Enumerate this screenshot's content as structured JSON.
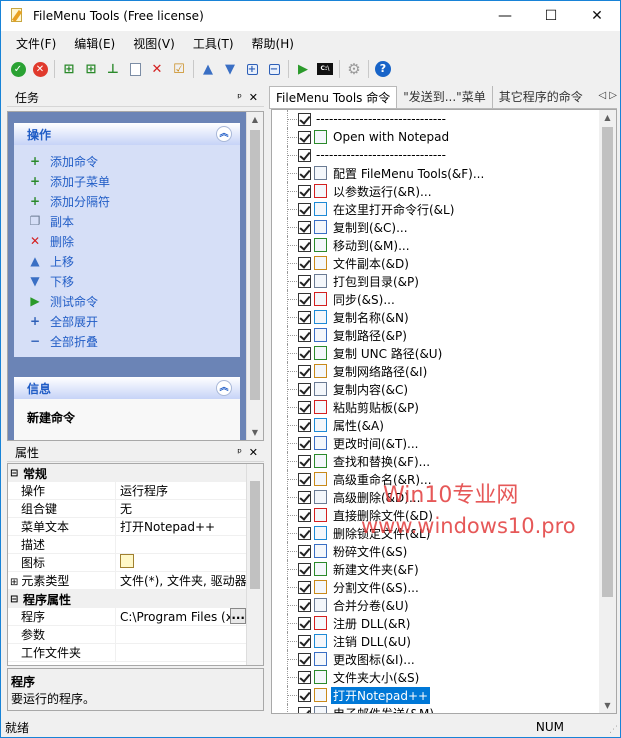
{
  "window": {
    "title": "FileMenu Tools (Free license)",
    "minimize": "—",
    "maximize": "☐",
    "close": "✕"
  },
  "menu": [
    "文件(F)",
    "编辑(E)",
    "视图(V)",
    "工具(T)",
    "帮助(H)"
  ],
  "tasks_pane": {
    "title": "任务",
    "pin": "ᵖ",
    "close": "✕",
    "group_actions": {
      "title": "操作",
      "items": [
        {
          "label": "添加命令",
          "icon": "add-command-icon",
          "glyph": "+",
          "color": "#2b8a2b"
        },
        {
          "label": "添加子菜单",
          "icon": "add-submenu-icon",
          "glyph": "+",
          "color": "#2b8a2b"
        },
        {
          "label": "添加分隔符",
          "icon": "add-separator-icon",
          "glyph": "+",
          "color": "#2b8a2b"
        },
        {
          "label": "副本",
          "icon": "copy-icon",
          "glyph": "❐",
          "color": "#6b7b93"
        },
        {
          "label": "删除",
          "icon": "delete-icon",
          "glyph": "✕",
          "color": "#d42020"
        },
        {
          "label": "上移",
          "icon": "move-up-icon",
          "glyph": "▲",
          "color": "#3a6fc4"
        },
        {
          "label": "下移",
          "icon": "move-down-icon",
          "glyph": "▼",
          "color": "#3a6fc4"
        },
        {
          "label": "测试命令",
          "icon": "run-test-icon",
          "glyph": "▶",
          "color": "#2b9a2b"
        },
        {
          "label": "全部展开",
          "icon": "expand-all-icon",
          "glyph": "+",
          "color": "#2d5fb7"
        },
        {
          "label": "全部折叠",
          "icon": "collapse-all-icon",
          "glyph": "−",
          "color": "#2d5fb7"
        }
      ]
    },
    "group_info": {
      "title": "信息",
      "heading": "新建命令"
    }
  },
  "props_pane": {
    "title": "属性",
    "pin": "ᵖ",
    "close": "✕",
    "cat_general": "常规",
    "rows_general": [
      {
        "k": "操作",
        "v": "运行程序"
      },
      {
        "k": "组合键",
        "v": "无"
      },
      {
        "k": "菜单文本",
        "v": "打开Notepad++"
      },
      {
        "k": "描述",
        "v": ""
      },
      {
        "k": "图标",
        "v": ""
      },
      {
        "k": "元素类型",
        "v": "文件(*), 文件夹, 驱动器"
      }
    ],
    "cat_program": "程序属性",
    "rows_program": [
      {
        "k": "程序",
        "v": "C:\\Program Files (x86"
      },
      {
        "k": "参数",
        "v": ""
      },
      {
        "k": "工作文件夹",
        "v": ""
      }
    ],
    "browse": "...",
    "desc_title": "程序",
    "desc_text": "要运行的程序。"
  },
  "tabs": [
    "FileMenu Tools 命令",
    "\"发送到...\"菜单",
    "其它程序的命令"
  ],
  "tab_nav": "◁ ▷",
  "commands": [
    {
      "label": "------------------------------",
      "icon": ""
    },
    {
      "label": "Open with Notepad",
      "icon": "notepad-icon"
    },
    {
      "label": "------------------------------",
      "icon": ""
    },
    {
      "label": "配置 FileMenu Tools(&F)...",
      "icon": "config-icon"
    },
    {
      "label": "以参数运行(&R)...",
      "icon": "run-params-icon"
    },
    {
      "label": "在这里打开命令行(&L)",
      "icon": "terminal-icon"
    },
    {
      "label": "复制到(&C)...",
      "icon": "copy-to-icon"
    },
    {
      "label": "移动到(&M)...",
      "icon": "move-to-icon"
    },
    {
      "label": "文件副本(&D)",
      "icon": "file-copy-icon"
    },
    {
      "label": "打包到目录(&P)",
      "icon": "pack-folder-icon"
    },
    {
      "label": "同步(&S)...",
      "icon": "sync-icon"
    },
    {
      "label": "复制名称(&N)",
      "icon": "copy-name-icon"
    },
    {
      "label": "复制路径(&P)",
      "icon": "copy-path-icon"
    },
    {
      "label": "复制 UNC 路径(&U)",
      "icon": "copy-unc-icon"
    },
    {
      "label": "复制网络路径(&I)",
      "icon": "copy-network-icon"
    },
    {
      "label": "复制内容(&C)",
      "icon": "copy-content-icon"
    },
    {
      "label": "粘贴剪贴板(&P)",
      "icon": "paste-icon"
    },
    {
      "label": "属性(&A)",
      "icon": "attributes-icon"
    },
    {
      "label": "更改时间(&T)...",
      "icon": "clock-icon"
    },
    {
      "label": "查找和替换(&F)...",
      "icon": "find-replace-icon"
    },
    {
      "label": "高级重命名(&R)...",
      "icon": "rename-icon"
    },
    {
      "label": "高级删除(&D)...",
      "icon": "adv-delete-icon"
    },
    {
      "label": "直接删除文件(&D)",
      "icon": "delete-icon"
    },
    {
      "label": "删除锁定文件(&L)",
      "icon": "locked-delete-icon"
    },
    {
      "label": "粉碎文件(&S)",
      "icon": "shred-icon"
    },
    {
      "label": "新建文件夹(&F)",
      "icon": "new-folder-icon"
    },
    {
      "label": "分割文件(&S)...",
      "icon": "split-icon"
    },
    {
      "label": "合并分卷(&U)",
      "icon": "join-icon"
    },
    {
      "label": "注册 DLL(&R)",
      "icon": "register-dll-icon"
    },
    {
      "label": "注销 DLL(&U)",
      "icon": "unregister-dll-icon"
    },
    {
      "label": "更改图标(&I)...",
      "icon": "change-icon-icon"
    },
    {
      "label": "文件夹大小(&S)",
      "icon": "pie-icon"
    },
    {
      "label": "打开Notepad++",
      "icon": "notepad-plus-icon",
      "selected": true
    },
    {
      "label": "电子邮件发送(&M)",
      "icon": "email-icon"
    }
  ],
  "watermark": {
    "line1": "Win10专业网",
    "line2": "www.windows10.pro"
  },
  "status": {
    "left": "就绪",
    "right": "NUM"
  }
}
